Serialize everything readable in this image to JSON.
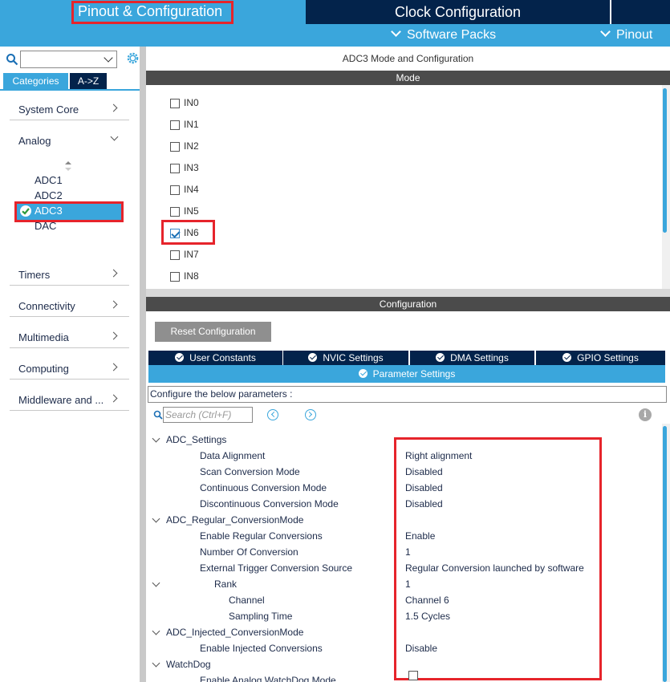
{
  "top_tabs": {
    "pinout": "Pinout & Configuration",
    "clock": "Clock Configuration"
  },
  "sub_menu": {
    "software_packs": "Software Packs",
    "pinout": "Pinout"
  },
  "sidebar": {
    "tab_categories": "Categories",
    "tab_az": "A->Z",
    "categories": [
      {
        "label": "System Core"
      },
      {
        "label": "Analog"
      },
      {
        "label": "Timers"
      },
      {
        "label": "Connectivity"
      },
      {
        "label": "Multimedia"
      },
      {
        "label": "Computing"
      },
      {
        "label": "Middleware and ..."
      }
    ],
    "analog_items": [
      "ADC1",
      "ADC2",
      "ADC3",
      "DAC"
    ]
  },
  "mode": {
    "title": "ADC3 Mode and Configuration",
    "header": "Mode",
    "channels": [
      {
        "label": "IN0",
        "checked": false
      },
      {
        "label": "IN1",
        "checked": false
      },
      {
        "label": "IN2",
        "checked": false
      },
      {
        "label": "IN3",
        "checked": false
      },
      {
        "label": "IN4",
        "checked": false
      },
      {
        "label": "IN5",
        "checked": false
      },
      {
        "label": "IN6",
        "checked": true
      },
      {
        "label": "IN7",
        "checked": false
      },
      {
        "label": "IN8",
        "checked": false
      }
    ]
  },
  "configuration": {
    "header": "Configuration",
    "reset_button": "Reset Configuration",
    "tabs": [
      "User Constants",
      "NVIC Settings",
      "DMA Settings",
      "GPIO Settings"
    ],
    "active_tab": "Parameter Settings",
    "configure_text": "Configure the below parameters :",
    "search_placeholder": "Search (Ctrl+F)"
  },
  "parameters": [
    {
      "name": "ADC_Settings",
      "value": ""
    },
    {
      "name": "Data Alignment",
      "value": "Right alignment"
    },
    {
      "name": "Scan Conversion Mode",
      "value": "Disabled"
    },
    {
      "name": "Continuous Conversion Mode",
      "value": "Disabled"
    },
    {
      "name": "Discontinuous Conversion Mode",
      "value": "Disabled"
    },
    {
      "name": "ADC_Regular_ConversionMode",
      "value": ""
    },
    {
      "name": "Enable Regular Conversions",
      "value": "Enable"
    },
    {
      "name": "Number Of Conversion",
      "value": "1"
    },
    {
      "name": "External Trigger Conversion Source",
      "value": "Regular Conversion launched by software"
    },
    {
      "name": "Rank",
      "value": "1"
    },
    {
      "name": "Channel",
      "value": "Channel 6"
    },
    {
      "name": "Sampling Time",
      "value": "1.5 Cycles"
    },
    {
      "name": "ADC_Injected_ConversionMode",
      "value": ""
    },
    {
      "name": "Enable Injected Conversions",
      "value": "Disable"
    },
    {
      "name": "WatchDog",
      "value": ""
    },
    {
      "name": "Enable Analog WatchDog Mode",
      "value": ""
    }
  ],
  "colors": {
    "accent": "#3aa6dc",
    "navy": "#03234b",
    "highlight": "#e6242b",
    "header_gray": "#4b4b4b"
  }
}
